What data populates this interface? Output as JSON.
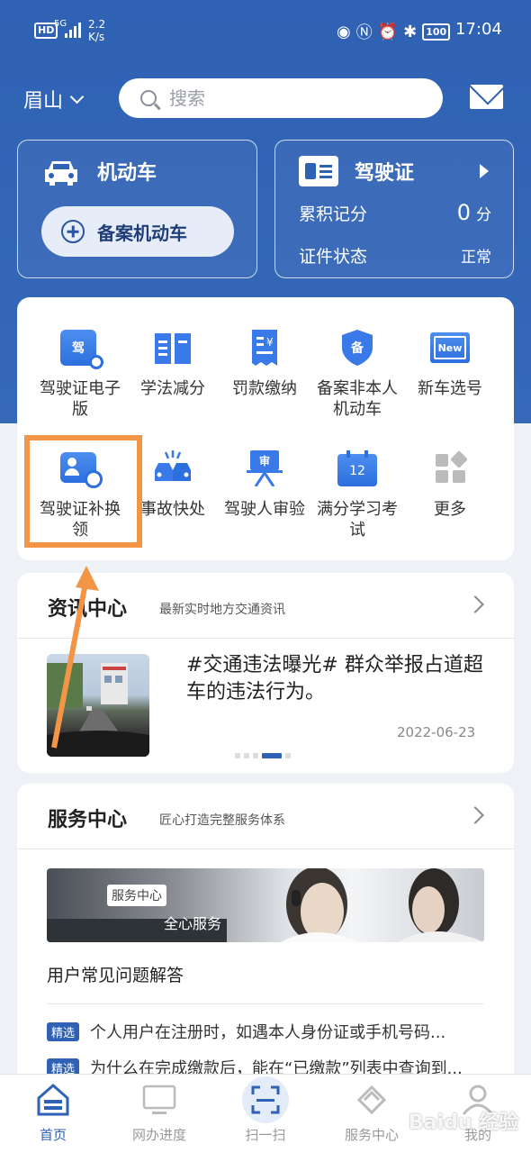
{
  "status_bar": {
    "hd": "HD",
    "network": "5G",
    "speed_value": "2.2",
    "speed_unit": "K/s",
    "battery": "100",
    "time": "17:04"
  },
  "header": {
    "city": "眉山",
    "search_placeholder": "搜索"
  },
  "vehicle_card": {
    "title": "机动车",
    "add_button": "备案机动车"
  },
  "license_card": {
    "title": "驾驶证",
    "points_label": "累积记分",
    "points_value": "0",
    "points_unit": "分",
    "status_label": "证件状态",
    "status_value": "正常"
  },
  "services": [
    {
      "label": "驾驶证电子版",
      "icon": "e-license-icon"
    },
    {
      "label": "学法减分",
      "icon": "book-icon"
    },
    {
      "label": "罚款缴纳",
      "icon": "fine-receipt-icon"
    },
    {
      "label": "备案非本人机动车",
      "icon": "shield-record-icon"
    },
    {
      "label": "新车选号",
      "icon": "new-plate-icon"
    },
    {
      "label": "驾驶证补换领",
      "icon": "license-renew-icon"
    },
    {
      "label": "事故快处",
      "icon": "accident-icon"
    },
    {
      "label": "驾驶人审验",
      "icon": "review-icon"
    },
    {
      "label": "满分学习考试",
      "icon": "calendar-12-icon"
    },
    {
      "label": "更多",
      "icon": "more-grid-icon"
    }
  ],
  "icon_text": {
    "jia": "驾",
    "bei": "备",
    "new": "New",
    "shen": "审",
    "twelve": "12"
  },
  "news": {
    "title": "资讯中心",
    "subtitle": "最新实时地方交通资讯",
    "headline": "#交通违法曝光# 群众举报占道超车的违法行为。",
    "date": "2022-06-23"
  },
  "service_center": {
    "title": "服务中心",
    "subtitle": "匠心打造完整服务体系",
    "banner_tag": "服务中心",
    "banner_slogan": "全心服务",
    "faq_title": "用户常见问题解答",
    "faqs": [
      {
        "badge": "精选",
        "text": "个人用户在注册时，如遇本人身份证或手机号码..."
      },
      {
        "badge": "精选",
        "text": "为什么在完成缴款后，能在“已缴款”列表中查询到..."
      }
    ]
  },
  "tabbar": [
    {
      "label": "首页",
      "icon": "home-icon"
    },
    {
      "label": "网办进度",
      "icon": "monitor-icon"
    },
    {
      "label": "扫一扫",
      "icon": "scan-icon"
    },
    {
      "label": "服务中心",
      "icon": "service-icon"
    },
    {
      "label": "我的",
      "icon": "profile-icon"
    }
  ],
  "watermark": "Baidu 经验",
  "colors": {
    "primary": "#2f62b4",
    "accent": "#f39547",
    "tab_active": "#2f62b4"
  }
}
